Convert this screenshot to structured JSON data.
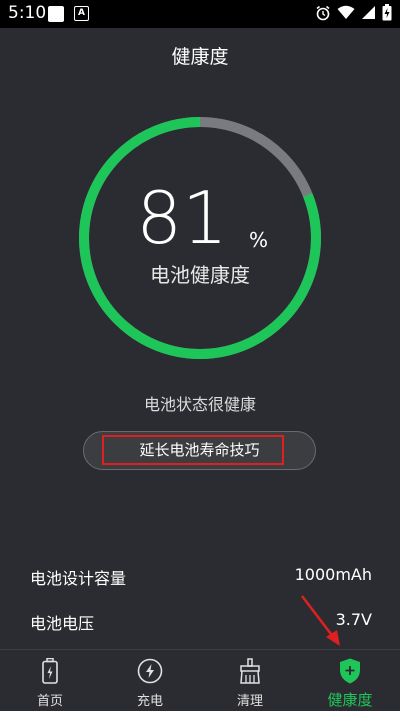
{
  "status_bar": {
    "time": "5:10",
    "notification_icon": "A"
  },
  "header": {
    "title": "健康度"
  },
  "gauge": {
    "value": "81",
    "percent_sign": "%",
    "label": "电池健康度",
    "fraction": 0.81,
    "colors": {
      "fill": "#1ec65a",
      "track": "#7a7b7f"
    }
  },
  "health_status": "电池状态很健康",
  "tips_button": {
    "label": "延长电池寿命技巧"
  },
  "info": [
    {
      "label": "电池设计容量",
      "value": "1000mAh"
    },
    {
      "label": "电池电压",
      "value": "3.7V"
    }
  ],
  "nav": {
    "items": [
      {
        "label": "首页",
        "icon": "battery-icon"
      },
      {
        "label": "充电",
        "icon": "lightning-icon"
      },
      {
        "label": "清理",
        "icon": "broom-icon"
      },
      {
        "label": "健康度",
        "icon": "shield-plus-icon",
        "active": true
      }
    ],
    "accent_color": "#1ec65a"
  },
  "annotations": {
    "highlight_color": "#e02020"
  }
}
